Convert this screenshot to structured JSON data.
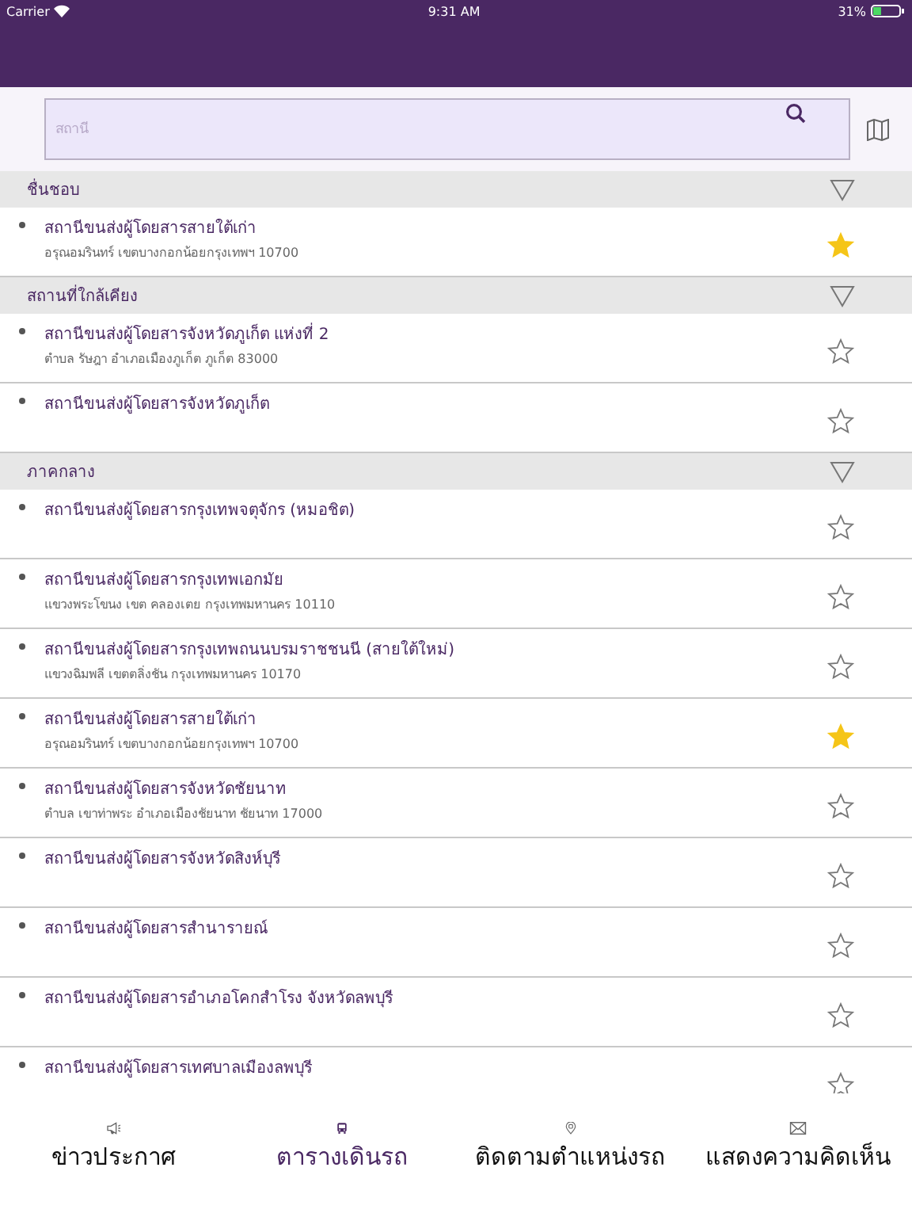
{
  "status_bar": {
    "carrier": "Carrier",
    "time": "9:31 AM",
    "battery": "31%"
  },
  "search": {
    "placeholder": "สถานี"
  },
  "sections": [
    {
      "title": "ชื่นชอบ",
      "stations": [
        {
          "name": "สถานีขนส่งผู้โดยสารสายใต้เก่า",
          "address": "อรุณอมรินทร์ เขตบางกอกน้อยกรุงเทพฯ 10700",
          "favorite": true
        }
      ]
    },
    {
      "title": "สถานที่ใกล้เคียง",
      "stations": [
        {
          "name": "สถานีขนส่งผู้โดยสารจังหวัดภูเก็ต แห่งที่ 2",
          "address": "ตำบล รัษฎา อำเภอเมืองภูเก็ต ภูเก็ต 83000",
          "favorite": false
        },
        {
          "name": "สถานีขนส่งผู้โดยสารจังหวัดภูเก็ต",
          "favorite": false
        }
      ]
    },
    {
      "title": "ภาคกลาง",
      "stations": [
        {
          "name": "สถานีขนส่งผู้โดยสารกรุงเทพจตุจักร (หมอชิต)",
          "favorite": false
        },
        {
          "name": "สถานีขนส่งผู้โดยสารกรุงเทพเอกมัย",
          "address": "แขวงพระโขนง เขต คลองเตย กรุงเทพมหานคร 10110",
          "favorite": false
        },
        {
          "name": "สถานีขนส่งผู้โดยสารกรุงเทพถนนบรมราชชนนี (สายใต้ใหม่)",
          "address": "แขวงฉิมพลี เขตตลิ่งชัน กรุงเทพมหานคร 10170",
          "favorite": false
        },
        {
          "name": "สถานีขนส่งผู้โดยสารสายใต้เก่า",
          "address": "อรุณอมรินทร์ เขตบางกอกน้อยกรุงเทพฯ 10700",
          "favorite": true
        },
        {
          "name": "สถานีขนส่งผู้โดยสารจังหวัดชัยนาท",
          "address": "ตำบล เขาท่าพระ อำเภอเมืองชัยนาท ชัยนาท 17000",
          "favorite": false
        },
        {
          "name": "สถานีขนส่งผู้โดยสารจังหวัดสิงห์บุรี",
          "favorite": false
        },
        {
          "name": "สถานีขนส่งผู้โดยสารสำนารายณ์",
          "favorite": false
        },
        {
          "name": "สถานีขนส่งผู้โดยสารอำเภอโคกสำโรง จังหวัดลพบุรี",
          "favorite": false
        },
        {
          "name": "สถานีขนส่งผู้โดยสารเทศบาลเมืองลพบุรี",
          "favorite": false
        }
      ]
    }
  ],
  "tabs": [
    {
      "kind": "news",
      "label": "ข่าวประกาศ",
      "selected": false
    },
    {
      "kind": "schedule",
      "label": "ตารางเดินรถ",
      "selected": true
    },
    {
      "kind": "tracking",
      "label": "ติดตามตำแหน่งรถ",
      "selected": false
    },
    {
      "kind": "feedback",
      "label": "แสดงความคิดเห็น",
      "selected": false
    }
  ]
}
